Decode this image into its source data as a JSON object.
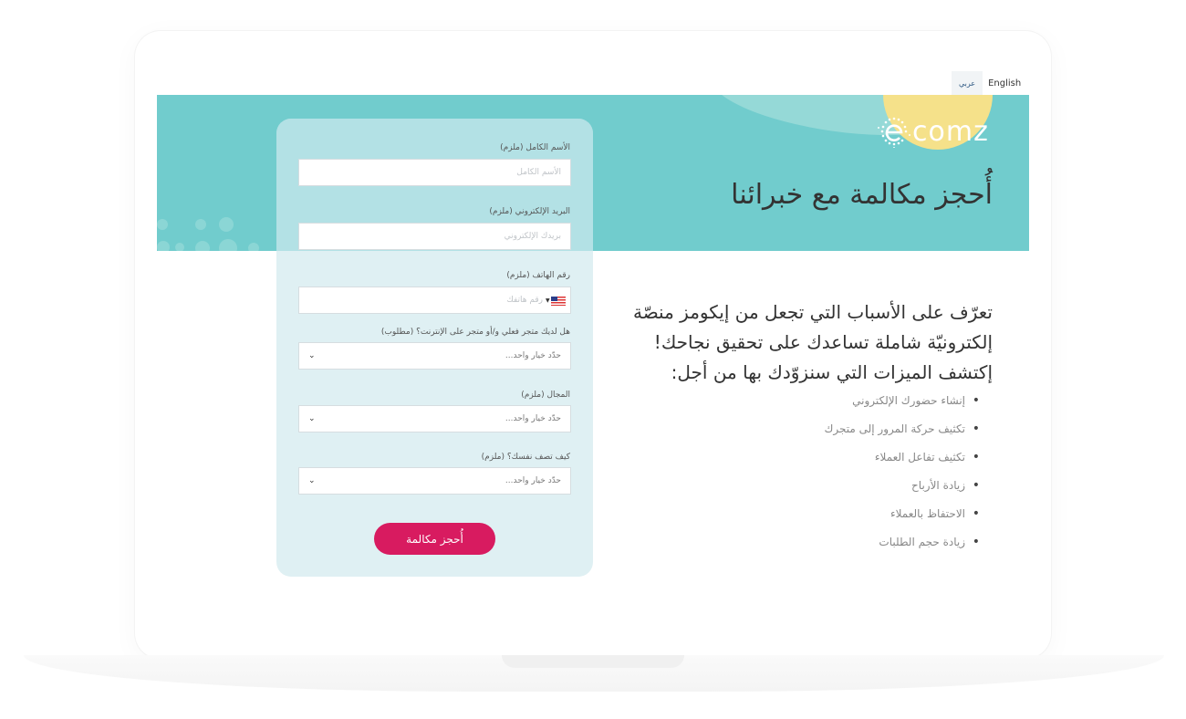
{
  "language_switch": {
    "arabic": "عربي",
    "english": "English"
  },
  "brand": {
    "logo_text": "comz"
  },
  "banner": {
    "title": "أُحجز مكالمة مع خبرائنا"
  },
  "form": {
    "full_name": {
      "label": "الأسم الكامل (ملزم)",
      "placeholder": "الأسم الكامل"
    },
    "email": {
      "label": "البريد الإلكتروني (ملزم)",
      "placeholder": "بريدك الإلكتروني"
    },
    "phone": {
      "label": "رقم الهاتف (ملزم)",
      "placeholder": "رقم هاتفك"
    },
    "store": {
      "label": "هل لديك متجر فعلي و/أو متجر على الإنترنت؟ (مطلوب)",
      "value": "حدّد خيار واحد..."
    },
    "field": {
      "label": "المجال (ملزم)",
      "value": "حدّد خيار واحد..."
    },
    "self_desc": {
      "label": "كيف تصف نفسك؟ (ملزم)",
      "value": "حدّد خيار واحد..."
    },
    "submit_label": "أُحجز مكالمة"
  },
  "intro": {
    "line1": "تعرّف على الأسباب التي تجعل من إيكومز منصّة",
    "line2": "إلكترونيّة شاملة تساعدك على تحقيق نجاحك!",
    "line3": "إكتشف الميزات التي سنزوّدك بها من أجل:"
  },
  "features": [
    "إنشاء حضورك الإلكتروني",
    "تكثيف حركة المرور إلى متجرك",
    "تكثيف تفاعل العملاء",
    "زيادة الأرباح",
    "الاحتفاظ بالعملاء",
    "زيادة حجم الطلبات"
  ],
  "colors": {
    "banner": "#71cccd",
    "button": "#d81b60",
    "accent_yellow": "#f5e18a"
  }
}
